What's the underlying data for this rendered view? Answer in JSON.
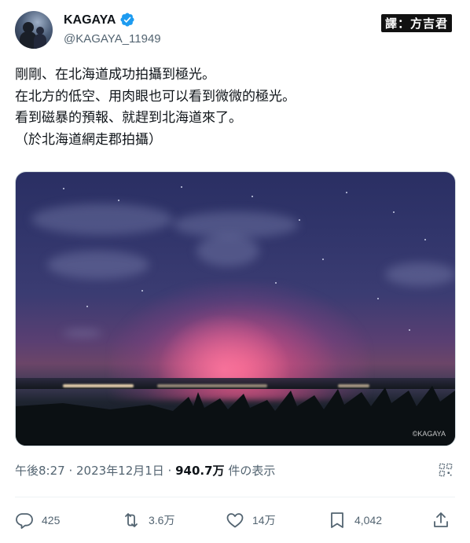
{
  "author": {
    "name": "KAGAYA",
    "handle": "@KAGAYA_11949",
    "verified_color": "#1d9bf0"
  },
  "translator_badge": "譯：方吉君",
  "tweet": {
    "lines": [
      "剛剛、在北海道成功拍攝到極光。",
      "在北方的低空、用肉眼也可以看到微微的極光。",
      "看到磁暴的預報、就趕到北海道來了。",
      "（於北海道網走郡拍攝）"
    ],
    "image_watermark": "©KAGAYA"
  },
  "meta": {
    "time_date": "午後8:27 · 2023年12月1日 · ",
    "views": "940.7万",
    "views_suffix": " 件の表示"
  },
  "actions": {
    "reply": {
      "icon": "reply-icon",
      "count": "425"
    },
    "retweet": {
      "icon": "retweet-icon",
      "count": "3.6万"
    },
    "like": {
      "icon": "heart-icon",
      "count": "14万"
    },
    "bookmark": {
      "icon": "bookmark-icon",
      "count": "4,042"
    },
    "share": {
      "icon": "share-icon"
    }
  }
}
